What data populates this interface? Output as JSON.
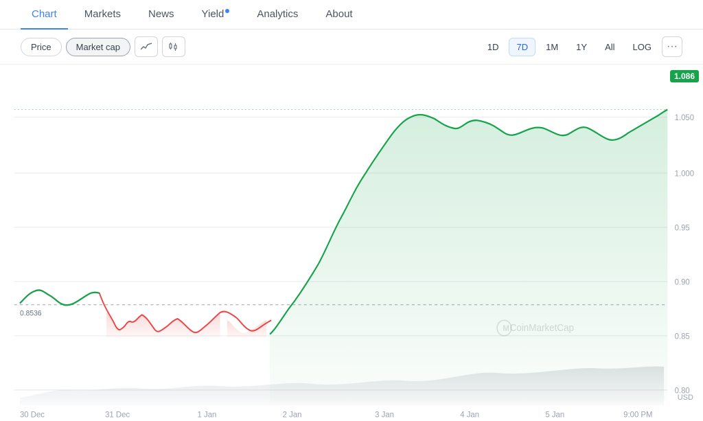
{
  "nav": {
    "tabs": [
      {
        "label": "Chart",
        "active": true
      },
      {
        "label": "Markets",
        "active": false
      },
      {
        "label": "News",
        "active": false
      },
      {
        "label": "Yield",
        "active": false,
        "dot": true
      },
      {
        "label": "Analytics",
        "active": false
      },
      {
        "label": "About",
        "active": false
      }
    ]
  },
  "toolbar": {
    "price_label": "Price",
    "market_cap_label": "Market cap",
    "time_buttons": [
      "1D",
      "7D",
      "1M",
      "1Y",
      "All",
      "LOG"
    ],
    "selected_time": "7D"
  },
  "chart": {
    "current_price": "1.086",
    "start_price": "0.8536",
    "currency": "USD",
    "watermark": "CoinMarketCap",
    "x_labels": [
      "30 Dec",
      "31 Dec",
      "1 Jan",
      "2 Jan",
      "3 Jan",
      "4 Jan",
      "5 Jan",
      "9:00 PM"
    ],
    "y_labels": [
      "1.050",
      "1.000",
      "0.95",
      "0.90",
      "0.85",
      "0.80"
    ],
    "colors": {
      "green_line": "#16a34a",
      "red_fill": "#fca5a5",
      "green_fill_start": "rgba(22,163,74,0.15)",
      "green_fill_end": "rgba(22,163,74,0.03)"
    }
  }
}
